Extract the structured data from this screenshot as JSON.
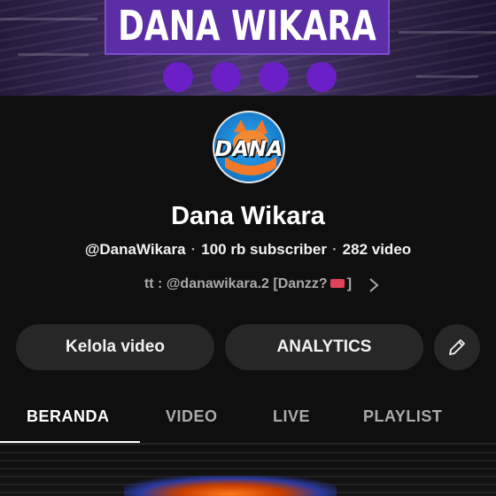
{
  "banner": {
    "title": "DANA WIKARA"
  },
  "avatar": {
    "text": "DANA"
  },
  "channel": {
    "name": "Dana Wikara",
    "handle": "@DanaWikara",
    "subscribers": "100 rb subscriber",
    "videos": "282 video",
    "description": "tt : @danawikara.2 [Danzz?",
    "description_end": "]"
  },
  "actions": {
    "manage_videos": "Kelola video",
    "analytics": "ANALYTICS"
  },
  "tabs": [
    {
      "label": "BERANDA",
      "active": true
    },
    {
      "label": "VIDEO",
      "active": false
    },
    {
      "label": "LIVE",
      "active": false
    },
    {
      "label": "PLAYLIST",
      "active": false
    }
  ],
  "icons": {
    "edit": "pencil-icon",
    "more": "chevron-right-icon",
    "ticket": "ticket-emoji-icon"
  },
  "colors": {
    "background": "#0f0f0f",
    "button": "#272727",
    "banner_accent": "#5b2ea6",
    "dot": "#6a1fc7",
    "muted_text": "#aaaaaa"
  }
}
